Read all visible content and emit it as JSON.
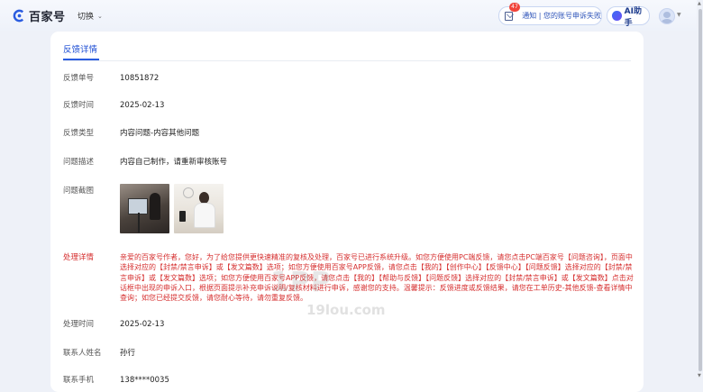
{
  "header": {
    "logo_text": "百家号",
    "switch_label": "切换",
    "notification_count": "47",
    "notification_text": "通知 | 您的账号申诉失败",
    "ai_label": "AI助手"
  },
  "card": {
    "tab_label": "反馈详情",
    "fields": [
      {
        "label": "反馈单号",
        "value": "10851872"
      },
      {
        "label": "反馈时间",
        "value": "2025-02-13"
      },
      {
        "label": "反馈类型",
        "value": "内容问题-内容其他问题"
      },
      {
        "label": "问题描述",
        "value": "内容自己制作，请重新审核账号"
      },
      {
        "label": "问题截图",
        "value": ""
      },
      {
        "label": "处理详情",
        "value": "亲爱的百家号作者，您好，为了给您提供更快速精准的复核及处理，百家号已进行系统升级。如您方便使用PC端反馈，请您点击PC端百家号【问题咨询】，页面中选择对应的【封禁/禁言申诉】或【发文篇数】选项；如您方便使用百家号APP反馈，请您点击【我的】【创作中心】【反馈中心】【问题反馈】选择对应的【封禁/禁言申诉】或【发文篇数】选项；如您方便使用百家号APP反馈，请您点击【我的】【帮助与反馈】【问题反馈】选择对应的【封禁/禁言申诉】或【发文篇数】点击对话框中出现的申诉入口，根据页面提示补充申诉说明/复核材料进行申诉，感谢您的支持。温馨提示：反馈进度或反馈结果，请您在工单历史-其他反馈-查看详情中查询；如您已经提交反馈，请您耐心等待，请勿重复反馈。"
      },
      {
        "label": "处理时间",
        "value": "2025-02-13"
      },
      {
        "label": "联系人姓名",
        "value": "孙行"
      },
      {
        "label": "联系手机",
        "value": "138****0035"
      }
    ]
  },
  "watermark": {
    "main": "1PP",
    "sub": "19lou.com"
  },
  "colors": {
    "accent": "#1f4fd4",
    "detail_text": "#d62f2f",
    "badge": "#f0443a"
  }
}
